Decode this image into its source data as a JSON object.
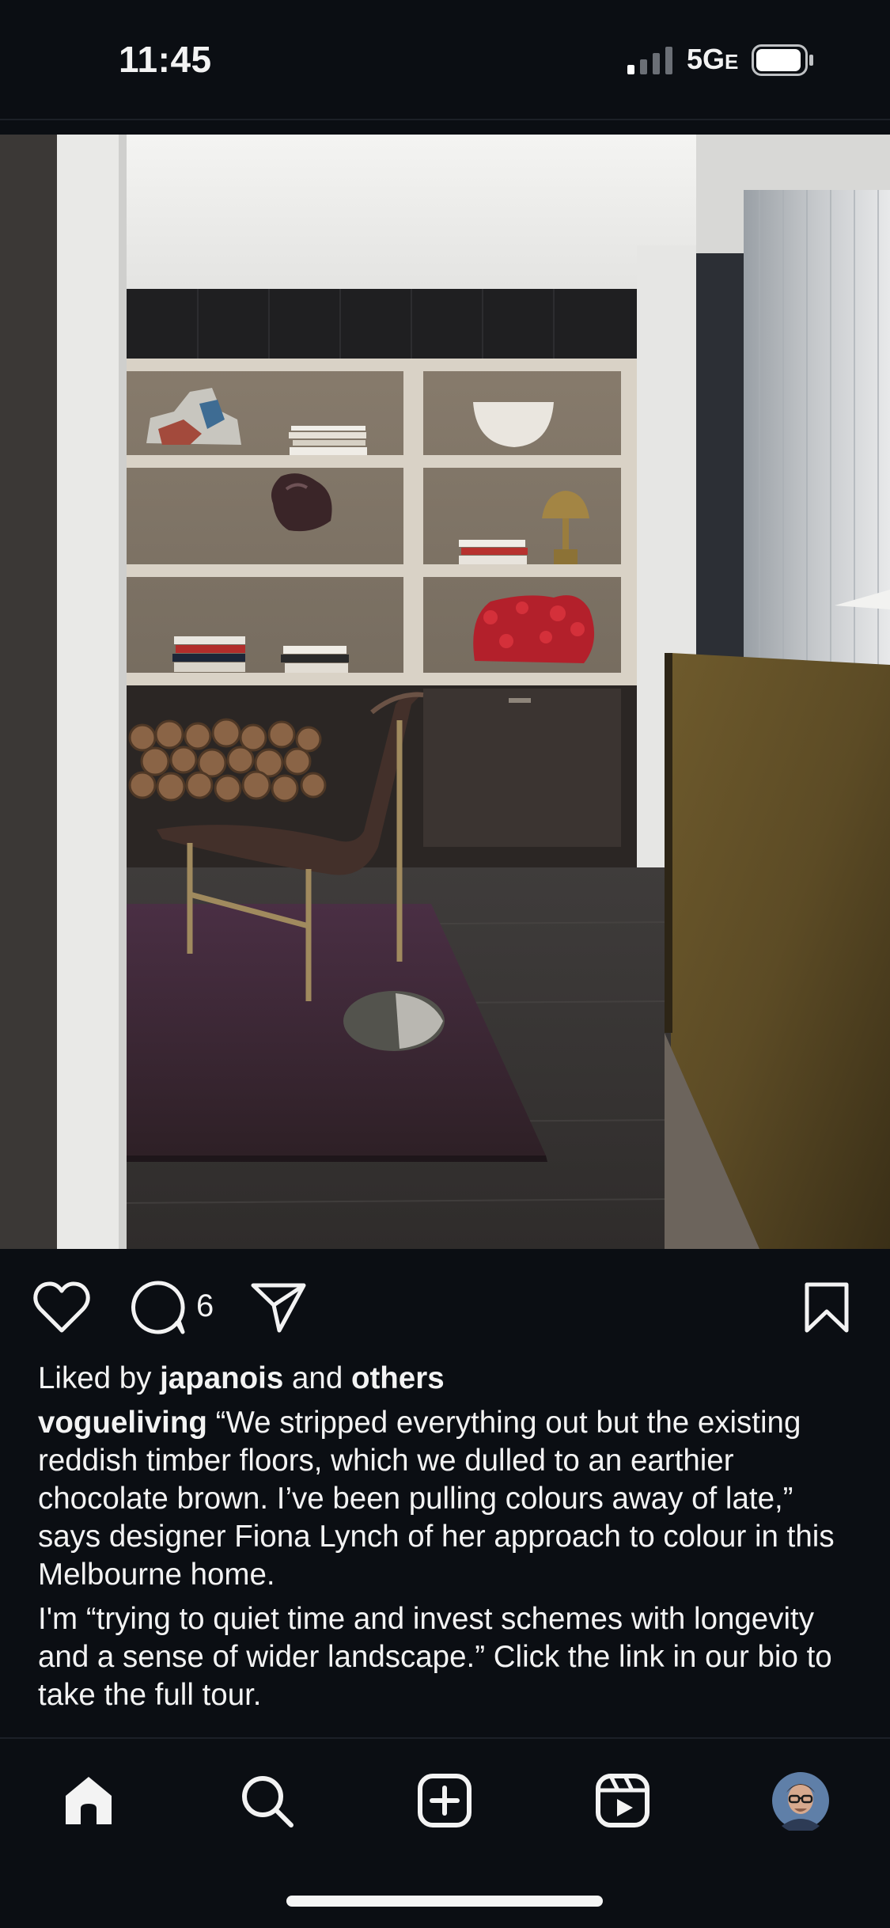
{
  "status_bar": {
    "time": "11:45",
    "network": "5G",
    "network_suffix": "E"
  },
  "post": {
    "comment_count": "6",
    "liked_by_prefix": "Liked by",
    "liked_by_user": "japanois",
    "liked_by_and": "and",
    "liked_by_others": "others",
    "author": "vogueliving",
    "caption_part1": "“We stripped everything out but the existing reddish timber floors, which we dulled to an earthier chocolate brown. I’ve been pulling colours away of late,” says designer Fiona Lynch of her approach to colour in this Melbourne home.",
    "caption_part2": "I'm “trying to quiet time and invest schemes with longevity and a sense of wider landscape.” Click the link in our bio to take the full tour."
  },
  "icons": {
    "like": "heart-icon",
    "comment": "comment-bubble-icon",
    "share": "paper-plane-icon",
    "save": "bookmark-icon",
    "nav": [
      "home-icon",
      "search-icon",
      "add-post-icon",
      "reels-icon",
      "profile-avatar"
    ]
  },
  "colors": {
    "background": "#0b0e13",
    "text": "#f3f3f3"
  }
}
